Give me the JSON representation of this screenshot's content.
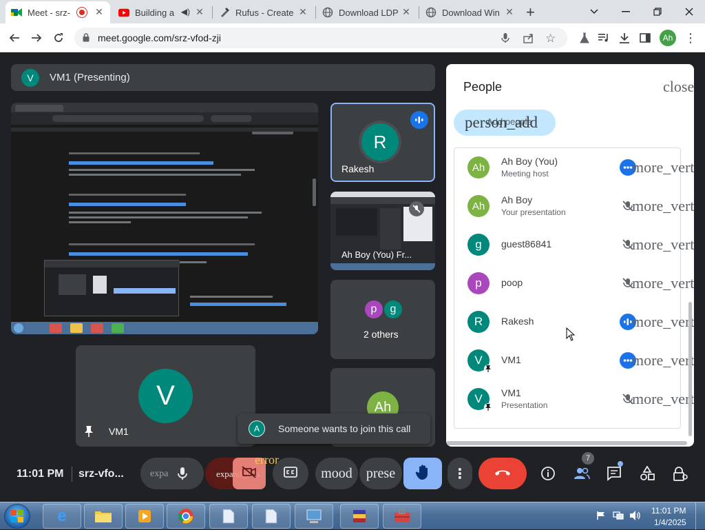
{
  "browser": {
    "tabs": [
      {
        "title": "Meet - srz-",
        "favicon": "meet-icon"
      },
      {
        "title": "Building a",
        "favicon": "youtube-icon"
      },
      {
        "title": "Rufus - Create",
        "favicon": "rufus-icon"
      },
      {
        "title": "Download LDP",
        "favicon": "globe-icon"
      },
      {
        "title": "Download Win",
        "favicon": "globe-icon"
      }
    ],
    "new_tab_label": "+",
    "url": "meet.google.com/srz-vfod-zji",
    "profile_initials": "Ah"
  },
  "presenting": {
    "avatar_letter": "V",
    "label": "VM1 (Presenting)"
  },
  "tiles": {
    "rakesh": {
      "name": "Rakesh",
      "avatar_letter": "R"
    },
    "ahboy": {
      "name": "Ah Boy (You) Fr..."
    },
    "others": {
      "label": "2 others",
      "avatars": [
        "p",
        "g"
      ]
    },
    "partial": {
      "avatar_letter": "Ah"
    },
    "self": {
      "name": "VM1",
      "avatar_letter": "V"
    }
  },
  "toast": {
    "avatar_letter": "A",
    "text": "Someone wants to join this call"
  },
  "people_panel": {
    "title": "People",
    "close_text": "close",
    "add_people_text": "person_add",
    "add_people_label": "Add people",
    "more_text": "more_vert",
    "participants": [
      {
        "initials": "Ah",
        "name": "Ah Boy (You)",
        "subtitle": "Meeting host",
        "color": "#7cb342",
        "state": "speaking",
        "pinned": false
      },
      {
        "initials": "Ah",
        "name": "Ah Boy",
        "subtitle": "Your presentation",
        "color": "#7cb342",
        "state": "muted",
        "pinned": false
      },
      {
        "initials": "g",
        "name": "guest86841",
        "subtitle": "",
        "color": "#00897b",
        "state": "muted",
        "pinned": false
      },
      {
        "initials": "p",
        "name": "poop",
        "subtitle": "",
        "color": "#ab47bc",
        "state": "muted",
        "pinned": false
      },
      {
        "initials": "R",
        "name": "Rakesh",
        "subtitle": "",
        "color": "#00897b",
        "state": "talking",
        "pinned": false
      },
      {
        "initials": "V",
        "name": "VM1",
        "subtitle": "",
        "color": "#00897b",
        "state": "speaking",
        "pinned": true
      },
      {
        "initials": "V",
        "name": "VM1",
        "subtitle": "Presentation",
        "color": "#00897b",
        "state": "muted",
        "pinned": true
      }
    ]
  },
  "controls": {
    "time": "11:01 PM",
    "meeting_code": "srz-vfo...",
    "expand_text": "expa",
    "expand_text_2": "expand_less",
    "error_badge": "error",
    "mood_text": "mood",
    "present_text": "prese",
    "people_count": "7"
  },
  "taskbar": {
    "time": "11:01 PM",
    "date": "1/4/2025"
  },
  "colors": {
    "meet_bg": "#202124",
    "tile_bg": "#3c4043",
    "accent_blue": "#8ab4f8",
    "end_call_red": "#ea4335",
    "avatar_green": "#00897b"
  }
}
